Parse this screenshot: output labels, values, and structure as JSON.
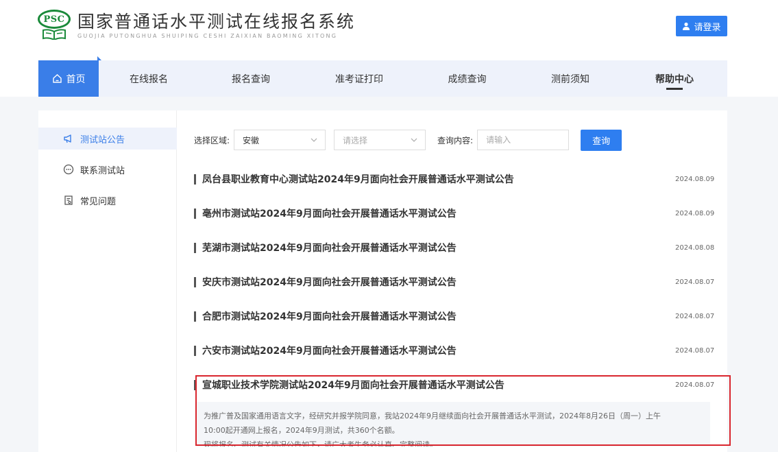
{
  "site": {
    "logo_mark": "PSC",
    "title": "国家普通话水平测试在线报名系统",
    "pinyin": "GUOJIA PUTONGHUA SHUIPING CESHI ZAIXIAN BAOMING XITONG"
  },
  "header": {
    "login_label": "请登录"
  },
  "nav": {
    "items": [
      {
        "label": "首页"
      },
      {
        "label": "在线报名"
      },
      {
        "label": "报名查询"
      },
      {
        "label": "准考证打印"
      },
      {
        "label": "成绩查询"
      },
      {
        "label": "测前须知"
      },
      {
        "label": "帮助中心"
      }
    ]
  },
  "sidebar": {
    "items": [
      {
        "label": "测试站公告",
        "icon": "megaphone-icon"
      },
      {
        "label": "联系测试站",
        "icon": "chat-bubble-icon"
      },
      {
        "label": "常见问题",
        "icon": "document-icon"
      }
    ]
  },
  "filter": {
    "region_label": "选择区域:",
    "region_value": "安徽",
    "second_select_placeholder": "请选择",
    "query_label": "查询内容:",
    "query_placeholder": "请输入",
    "query_button": "查询"
  },
  "announcements": [
    {
      "title": "凤台县职业教育中心测试站2024年9月面向社会开展普通话水平测试公告",
      "date": "2024.08.09"
    },
    {
      "title": "亳州市测试站2024年9月面向社会开展普通话水平测试公告",
      "date": "2024.08.09"
    },
    {
      "title": "芜湖市测试站2024年9月面向社会开展普通话水平测试公告",
      "date": "2024.08.08"
    },
    {
      "title": "安庆市测试站2024年9月面向社会开展普通话水平测试公告",
      "date": "2024.08.07"
    },
    {
      "title": "合肥市测试站2024年9月面向社会开展普通话水平测试公告",
      "date": "2024.08.07"
    },
    {
      "title": "六安市测试站2024年9月面向社会开展普通话水平测试公告",
      "date": "2024.08.07"
    },
    {
      "title": "宣城职业技术学院测试站2024年9月面向社会开展普通话水平测试公告",
      "date": "2024.08.07"
    }
  ],
  "excerpt": {
    "line1": "为推广普及国家通用语言文字，经研究并报学院同意，我站2024年9月继续面向社会开展普通话水平测试，2024年8月26日（周一）上午",
    "line2": "10:00起开通网上报名，2024年9月测试，共360个名额。",
    "line3": "现将报名、测试有关情况公告如下，请广大考生务必认真、完整阅读。"
  },
  "colors": {
    "accent": "#2e7ef0",
    "nav_active": "#3a7ee8",
    "nav_bg": "#eef2fb",
    "logo_green": "#1a8a3a",
    "highlight_border": "#d9262e"
  }
}
